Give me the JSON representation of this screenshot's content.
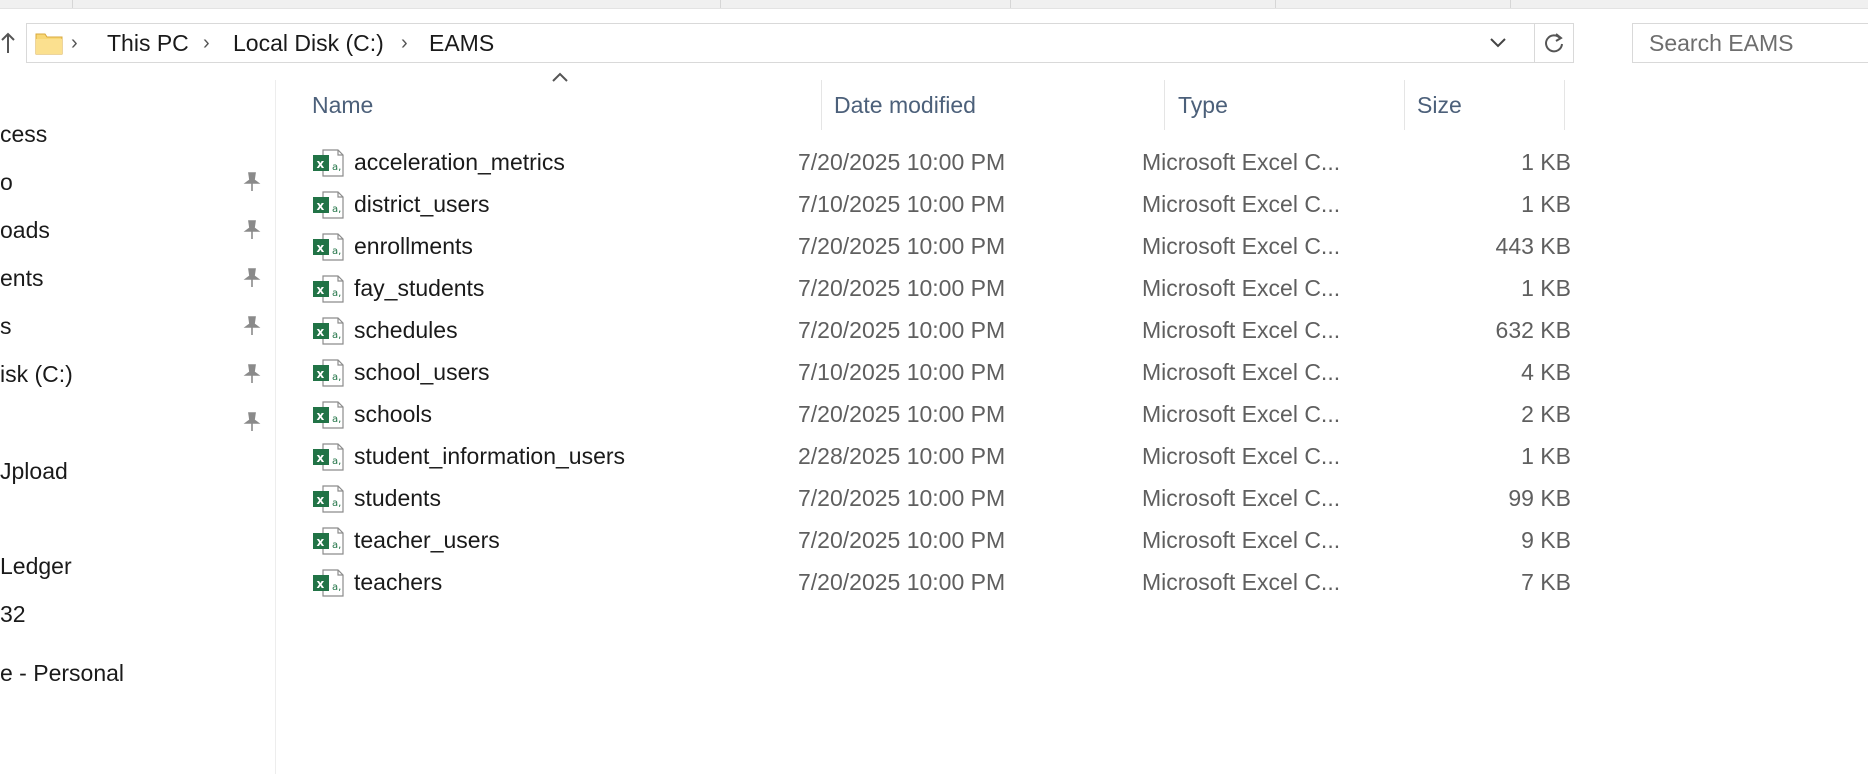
{
  "address_bar": {
    "crumbs": [
      "This PC",
      "Local Disk (C:)",
      "EAMS"
    ]
  },
  "search": {
    "placeholder": "Search EAMS"
  },
  "nav_pane": {
    "items": [
      {
        "label": "cess",
        "pinned": false
      },
      {
        "label": "o",
        "pinned": true
      },
      {
        "label": "oads",
        "pinned": true
      },
      {
        "label": "ents",
        "pinned": true
      },
      {
        "label": "s",
        "pinned": true
      },
      {
        "label": "isk (C:)",
        "pinned": true
      },
      {
        "label": "",
        "pinned": true
      },
      {
        "label": "Jpload",
        "pinned": false
      },
      {
        "label": "Ledger",
        "pinned": false
      },
      {
        "label": "32",
        "pinned": false
      },
      {
        "label": "e - Personal",
        "pinned": false
      }
    ]
  },
  "columns": {
    "name": "Name",
    "date": "Date modified",
    "type": "Type",
    "size": "Size"
  },
  "files": [
    {
      "name": "acceleration_metrics",
      "date": "7/20/2025 10:00 PM",
      "type": "Microsoft Excel C...",
      "size": "1 KB"
    },
    {
      "name": "district_users",
      "date": "7/10/2025 10:00 PM",
      "type": "Microsoft Excel C...",
      "size": "1 KB"
    },
    {
      "name": "enrollments",
      "date": "7/20/2025 10:00 PM",
      "type": "Microsoft Excel C...",
      "size": "443 KB"
    },
    {
      "name": "fay_students",
      "date": "7/20/2025 10:00 PM",
      "type": "Microsoft Excel C...",
      "size": "1 KB"
    },
    {
      "name": "schedules",
      "date": "7/20/2025 10:00 PM",
      "type": "Microsoft Excel C...",
      "size": "632 KB"
    },
    {
      "name": "school_users",
      "date": "7/10/2025 10:00 PM",
      "type": "Microsoft Excel C...",
      "size": "4 KB"
    },
    {
      "name": "schools",
      "date": "7/20/2025 10:00 PM",
      "type": "Microsoft Excel C...",
      "size": "2 KB"
    },
    {
      "name": "student_information_users",
      "date": "2/28/2025 10:00 PM",
      "type": "Microsoft Excel C...",
      "size": "1 KB"
    },
    {
      "name": "students",
      "date": "7/20/2025 10:00 PM",
      "type": "Microsoft Excel C...",
      "size": "99 KB"
    },
    {
      "name": "teacher_users",
      "date": "7/20/2025 10:00 PM",
      "type": "Microsoft Excel C...",
      "size": "9 KB"
    },
    {
      "name": "teachers",
      "date": "7/20/2025 10:00 PM",
      "type": "Microsoft Excel C...",
      "size": "7 KB"
    }
  ],
  "icons": {
    "file": "excel-csv-icon",
    "folder": "folder-icon",
    "pin": "pin-icon",
    "refresh": "refresh-icon",
    "dropdown": "chevron-down-icon",
    "up": "up-arrow-icon",
    "sort": "sort-ascending-icon"
  },
  "colors": {
    "excel_green": "#217346",
    "folder_yellow": "#f8d775",
    "header_text": "#4c607a"
  }
}
